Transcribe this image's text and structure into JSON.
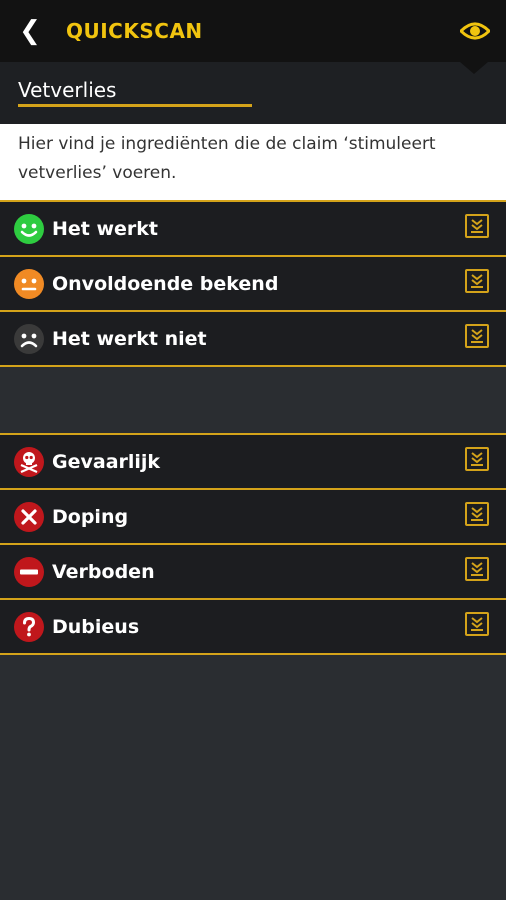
{
  "appbar": {
    "title": "QUICKSCAN"
  },
  "subheader": {
    "name": "Vetverlies"
  },
  "description": "Hier vind je ingrediënten die de claim ‘stimuleert vetverlies’ voeren.",
  "groups": [
    {
      "items": [
        {
          "label": "Het werkt",
          "icon": "smile-icon",
          "color": "#2ecc40"
        },
        {
          "label": "Onvoldoende bekend",
          "icon": "neutral-face-icon",
          "color": "#f08a24"
        },
        {
          "label": "Het werkt niet",
          "icon": "sad-face-icon",
          "color": "#3a3a3a"
        }
      ]
    },
    {
      "items": [
        {
          "label": "Gevaarlijk",
          "icon": "skull-icon",
          "color": "#c0171c"
        },
        {
          "label": "Doping",
          "icon": "x-icon",
          "color": "#c0171c"
        },
        {
          "label": "Verboden",
          "icon": "no-entry-icon",
          "color": "#c0171c"
        },
        {
          "label": "Dubieus",
          "icon": "question-icon",
          "color": "#c0171c"
        }
      ]
    }
  ]
}
